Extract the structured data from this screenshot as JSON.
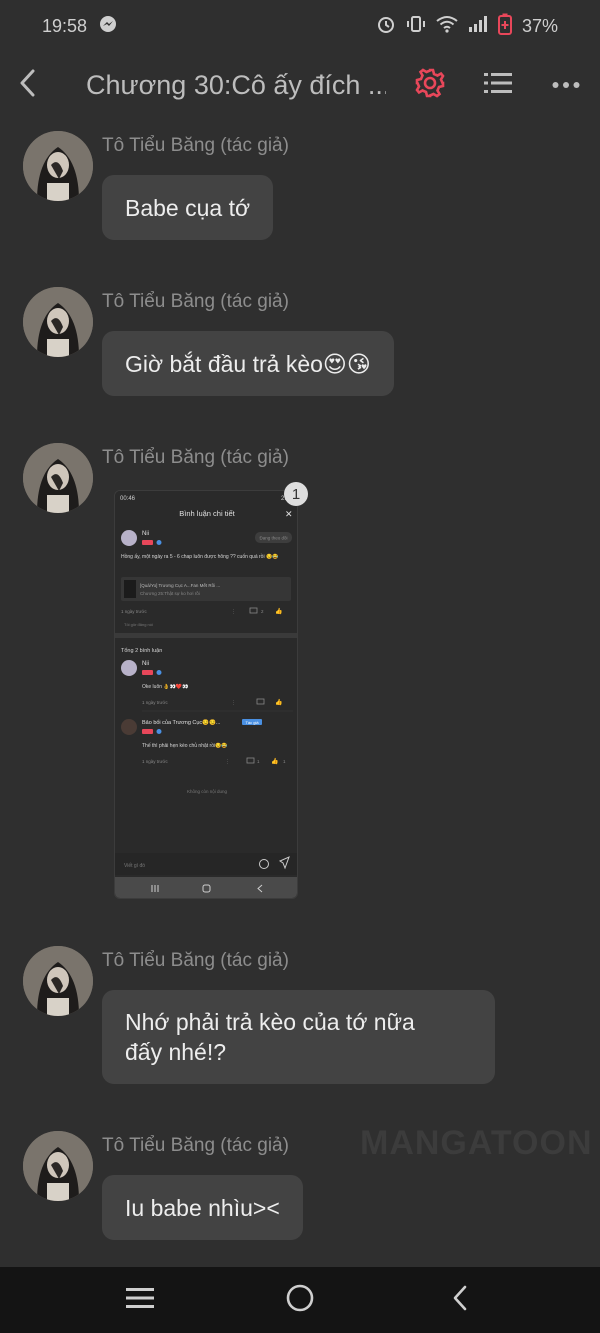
{
  "status_bar": {
    "time": "19:58",
    "battery_percent": "37%",
    "icons": [
      "messenger-icon",
      "alarm-icon",
      "vibrate-icon",
      "wifi-icon",
      "signal-icon",
      "battery-icon"
    ]
  },
  "header": {
    "title": "Chương 30:Cô ấy đích ...",
    "icons": [
      "back-icon",
      "settings-gear-icon",
      "list-icon",
      "more-icon"
    ],
    "accent_color": "#e8475a"
  },
  "messages": [
    {
      "author": "Tô Tiểu Băng (tác giả)",
      "text": "Babe cụa tớ"
    },
    {
      "author": "Tô Tiểu Băng (tác giả)",
      "text": "Giờ bắt đầu trả kèo😍😘"
    },
    {
      "author": "Tô Tiểu Băng (tác giả)",
      "image_badge": "1"
    },
    {
      "author": "Tô Tiểu Băng (tác giả)",
      "text": "Nhớ phải trả kèo của tớ nữa đấy nhé!?"
    },
    {
      "author": "Tô Tiểu Băng (tác giả)",
      "text": "Iu babe nhìu><"
    }
  ],
  "embedded_screenshot": {
    "status_time": "00:46",
    "status_right": "29",
    "title": "Bình luận chi tiết",
    "main_comment": {
      "user": "Nii",
      "follow_label": "Đang theo dõi",
      "text": "Hồng ấy, một ngày ra 5 - 6 chap luôn được hông ?? cuốn quá rồi 😏😂",
      "link_title": "[Quá/Yo] Trương Cục A...Fan Mết Rồi ...",
      "link_sub": "Chương 25:Thật sự ko hơi rồi",
      "time": "1 ngày trước",
      "reply_count": "2",
      "sub_text": "Tôi giờ đăng nói"
    },
    "replies_header": "Tổng 2 bình luận",
    "replies": [
      {
        "user": "Nii",
        "text": "Oke luôn 👌👀❤️👀",
        "time": "1 ngày trước"
      },
      {
        "user": "Bảo bối của Trương Cục😏😏...",
        "tag": "Tác giả",
        "text": "Thế thì phải hẹn kèo chủ nhật rồi😏😂",
        "time": "1 ngày trước",
        "reply_count": "1",
        "like_count": "1"
      }
    ],
    "no_more": "Không còn nội dung",
    "input_placeholder": "Viết gì đó"
  },
  "watermark": "MANGATOON",
  "bottom_nav": {
    "icons": [
      "menu-icon",
      "home-circle-icon",
      "back-chevron-icon"
    ]
  }
}
